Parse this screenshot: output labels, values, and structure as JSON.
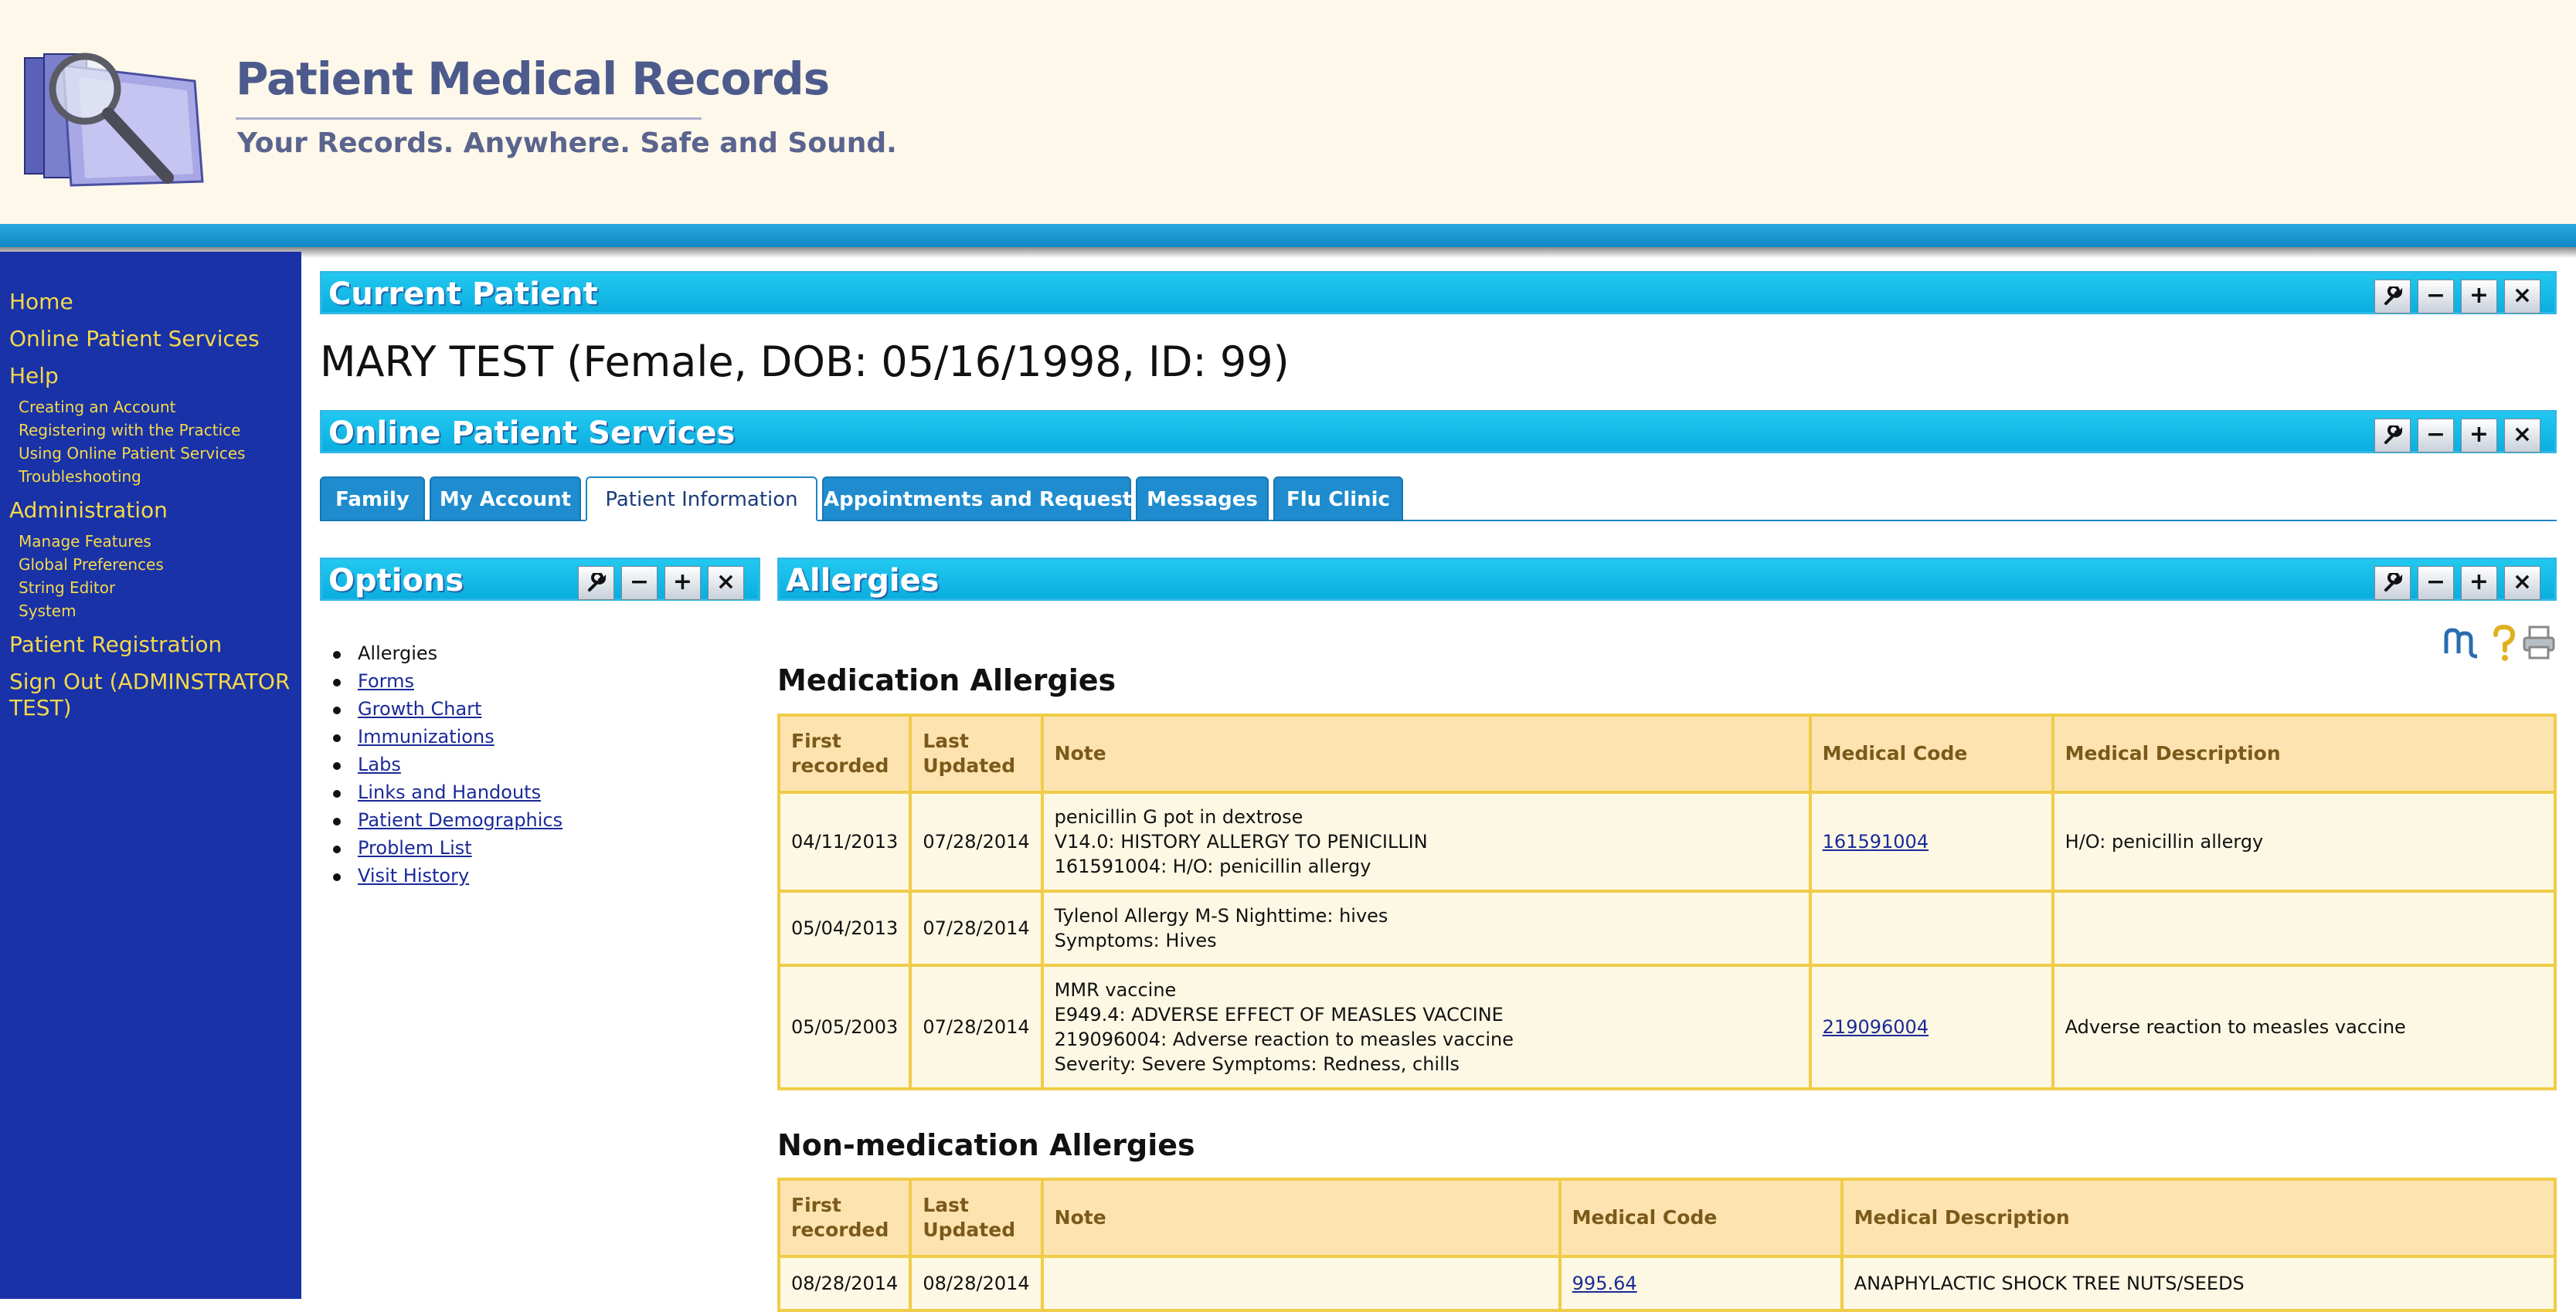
{
  "header": {
    "title": "Patient Medical Records",
    "tagline": "Your Records. Anywhere. Safe and Sound."
  },
  "sidebar": {
    "home": "Home",
    "online_services": "Online Patient Services",
    "help": "Help",
    "help_items": [
      "Creating an Account",
      "Registering with the Practice",
      "Using Online Patient Services",
      "Troubleshooting"
    ],
    "administration": "Administration",
    "admin_items": [
      "Manage Features",
      "Global Preferences",
      "String Editor",
      "System"
    ],
    "patient_registration": "Patient Registration",
    "sign_out_line1": "Sign Out (ADMINSTRATOR",
    "sign_out_line2": "TEST)"
  },
  "current_patient": {
    "bar_title": "Current Patient",
    "name": "MARY TEST (Female, DOB: 05/16/1998, ID: 99)"
  },
  "online_services": {
    "bar_title": "Online Patient Services",
    "tabs": [
      "Family",
      "My Account",
      "Patient Information",
      "Appointments and Requests",
      "Messages",
      "Flu Clinic"
    ],
    "active_tab": "Patient Information"
  },
  "panel_buttons": {
    "wrench": "wrench-icon",
    "minimize": "−",
    "maximize": "+",
    "close": "×"
  },
  "options": {
    "bar_title": "Options",
    "items": [
      "Allergies",
      "Forms",
      "Growth Chart",
      "Immunizations",
      "Labs",
      "Links and Handouts",
      "Patient Demographics",
      "Problem List",
      "Visit History"
    ],
    "current": "Allergies"
  },
  "allergies": {
    "bar_title": "Allergies",
    "medication": {
      "heading": "Medication Allergies",
      "headers": {
        "first_1": "First",
        "first_2": "recorded",
        "last_1": "Last",
        "last_2": "Updated",
        "note": "Note",
        "code": "Medical Code",
        "desc": "Medical Description"
      },
      "rows": [
        {
          "first": "04/11/2013",
          "last": "07/28/2014",
          "note": [
            "penicillin G pot in dextrose",
            "V14.0: HISTORY ALLERGY TO PENICILLIN",
            "161591004: H/O: penicillin allergy"
          ],
          "code": "161591004",
          "desc": "H/O: penicillin allergy"
        },
        {
          "first": "05/04/2013",
          "last": "07/28/2014",
          "note": [
            "Tylenol Allergy M-S Nighttime: hives",
            "Symptoms: Hives"
          ],
          "code": "",
          "desc": ""
        },
        {
          "first": "05/05/2003",
          "last": "07/28/2014",
          "note": [
            "MMR vaccine",
            "E949.4: ADVERSE EFFECT OF MEASLES VACCINE",
            "219096004: Adverse reaction to measles vaccine",
            "Severity: Severe Symptoms: Redness, chills"
          ],
          "code": "219096004",
          "desc": "Adverse reaction to measles vaccine"
        }
      ]
    },
    "non_medication": {
      "heading": "Non-medication Allergies",
      "rows": [
        {
          "first": "08/28/2014",
          "last": "08/28/2014",
          "note": "",
          "code": "995.64",
          "desc": "ANAPHYLACTIC SHOCK TREE NUTS/SEEDS"
        }
      ]
    },
    "tool_icons": [
      "refresh-icon",
      "help-icon",
      "print-icon"
    ]
  },
  "colors": {
    "sidebar": "#1932a8",
    "nav_text": "#f5d94a",
    "bar": "#0aaee0",
    "tab": "#1e8cce",
    "table_header": "#fde3b0",
    "table_border": "#f0cc48"
  }
}
